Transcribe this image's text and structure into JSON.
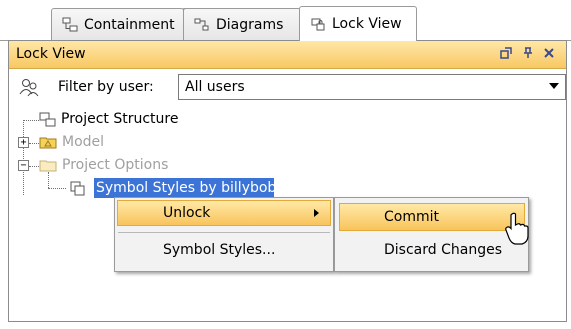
{
  "tabs": [
    {
      "label": "Containment",
      "icon": "containment-icon",
      "active": false
    },
    {
      "label": "Diagrams",
      "icon": "diagrams-icon",
      "active": false
    },
    {
      "label": "Lock View",
      "icon": "lock-view-icon",
      "active": true
    }
  ],
  "panel": {
    "title": "Lock View",
    "controls": [
      "restore-icon",
      "pin-icon",
      "close-icon"
    ]
  },
  "filter": {
    "label": "Filter by user:",
    "value": "All users",
    "icon": "users-filter-icon"
  },
  "tree": {
    "root": "Project Structure",
    "model": "Model",
    "options": "Project Options",
    "selected": "Symbol Styles by billybob"
  },
  "context_menu": {
    "unlock": "Unlock",
    "symbol_styles": "Symbol Styles..."
  },
  "submenu": {
    "commit": "Commit",
    "discard": "Discard Changes"
  },
  "colors": {
    "header": "#f8c863",
    "selection": "#3b74d6",
    "highlight": "#ffe9a6"
  }
}
